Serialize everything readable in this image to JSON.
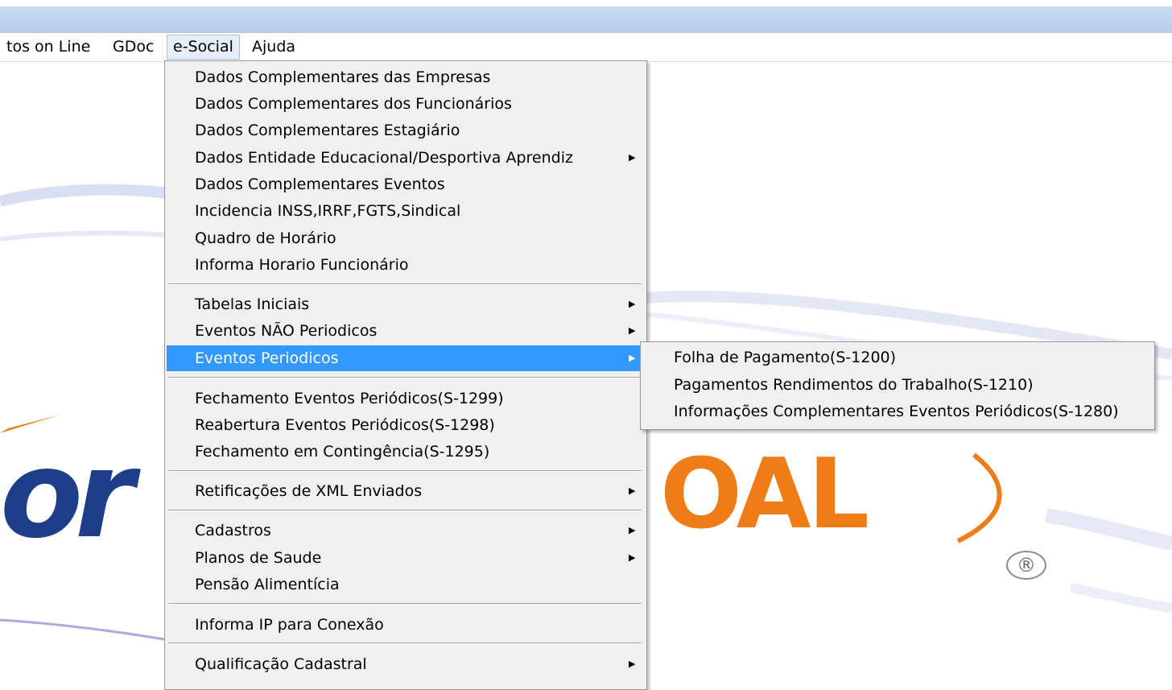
{
  "menubar": {
    "items": [
      {
        "label": "tos on Line"
      },
      {
        "label": "GDoc"
      },
      {
        "label": "e-Social"
      },
      {
        "label": "Ajuda"
      }
    ]
  },
  "background_logo": {
    "left_text": "or",
    "right_text": "OAL",
    "registered_mark": "®",
    "colors": {
      "blue": "#1f3e8a",
      "orange": "#ef7d17"
    }
  },
  "esocial_menu": {
    "items": [
      {
        "label": "Dados Complementares das Empresas",
        "submenu": false
      },
      {
        "label": "Dados Complementares dos Funcionários",
        "submenu": false
      },
      {
        "label": "Dados Complementares Estagiário",
        "submenu": false
      },
      {
        "label": "Dados Entidade Educacional/Desportiva Aprendiz",
        "submenu": true
      },
      {
        "label": "Dados Complementares Eventos",
        "submenu": false
      },
      {
        "label": "Incidencia INSS,IRRF,FGTS,Sindical",
        "submenu": false
      },
      {
        "label": "Quadro de Horário",
        "submenu": false
      },
      {
        "label": "Informa Horario Funcionário",
        "submenu": false
      },
      {
        "label": "Tabelas Iniciais",
        "submenu": true
      },
      {
        "label": "Eventos NÃO Periodicos",
        "submenu": true
      },
      {
        "label": "Eventos Periodicos",
        "submenu": true,
        "highlighted": true
      },
      {
        "label": "Fechamento Eventos Periódicos(S-1299)",
        "submenu": false
      },
      {
        "label": "Reabertura Eventos Periódicos(S-1298)",
        "submenu": false
      },
      {
        "label": "Fechamento em Contingência(S-1295)",
        "submenu": false
      },
      {
        "label": "Retificações de XML Enviados",
        "submenu": true
      },
      {
        "label": "Cadastros",
        "submenu": true
      },
      {
        "label": "Planos de Saude",
        "submenu": true
      },
      {
        "label": "Pensão Alimentícia",
        "submenu": false
      },
      {
        "label": "Informa IP para Conexão",
        "submenu": false
      },
      {
        "label": "Qualificação Cadastral",
        "submenu": true
      }
    ]
  },
  "periodicos_submenu": {
    "items": [
      {
        "label": "Folha de Pagamento(S-1200)"
      },
      {
        "label": "Pagamentos Rendimentos do Trabalho(S-1210)"
      },
      {
        "label": "Informações Complementares Eventos Periódicos(S-1280)"
      }
    ]
  },
  "colors": {
    "highlight": "#3399ff",
    "menu_bg": "#f0f0f0"
  }
}
